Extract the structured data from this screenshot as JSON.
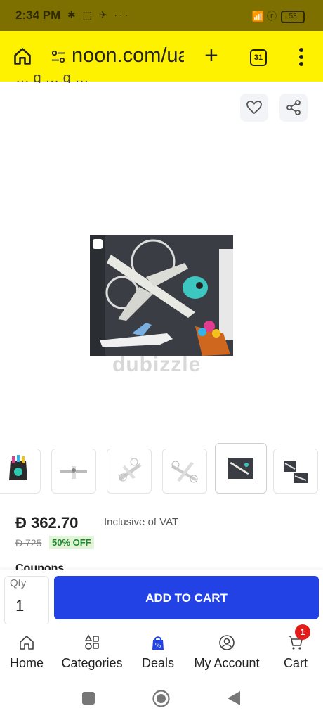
{
  "status_bar": {
    "time": "2:34 PM",
    "left_icons": "✱ ⬚ ✈ ···",
    "right_icons": "📶 ⓡ",
    "battery": "53"
  },
  "browser": {
    "url": "noon.com/ua",
    "tab_count": "31"
  },
  "product": {
    "title_partial": "… g … g …",
    "watermark": "dubizzle",
    "price": "362.70",
    "currency_symbol": "Ð",
    "vat_note": "Inclusive of VAT",
    "old_price": "725",
    "discount": "50% OFF",
    "coupons_label": "Coupons",
    "thumbnail_count": 6,
    "selected_thumbnail": 5
  },
  "cart": {
    "qty_label": "Qty",
    "qty_value": "1",
    "add_label": "ADD TO CART"
  },
  "nav": {
    "items": [
      {
        "label": "Home",
        "icon": "home-icon"
      },
      {
        "label": "Categories",
        "icon": "categories-icon"
      },
      {
        "label": "Deals",
        "icon": "deals-icon"
      },
      {
        "label": "My Account",
        "icon": "account-icon"
      },
      {
        "label": "Cart",
        "icon": "cart-icon"
      }
    ],
    "cart_badge": "1"
  },
  "colors": {
    "url_bar": "#fff200",
    "status_bar": "#7d7000",
    "add_button": "#2342e6",
    "discount_text": "#1b8a2d",
    "badge": "#e21b1b"
  }
}
